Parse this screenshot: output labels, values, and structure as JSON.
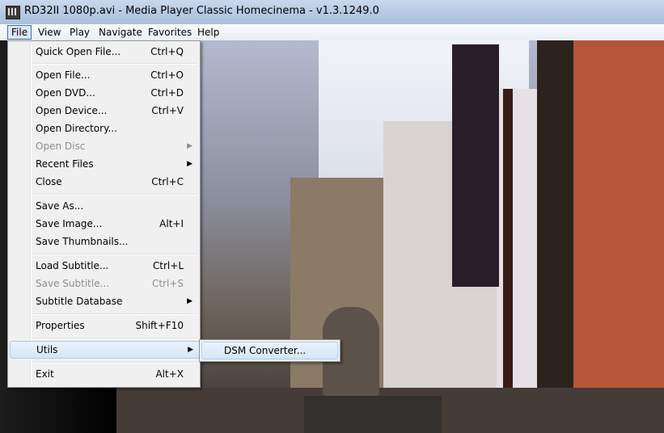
{
  "window": {
    "title": "RD32II 1080p.avi - Media Player Classic Homecinema - v1.3.1249.0",
    "icon": "film-icon"
  },
  "menubar": [
    "File",
    "View",
    "Play",
    "Navigate",
    "Favorites",
    "Help"
  ],
  "file_menu": {
    "items": [
      {
        "label": "Quick Open File...",
        "shortcut": "Ctrl+Q"
      },
      {
        "label": "Open File...",
        "shortcut": "Ctrl+O"
      },
      {
        "label": "Open DVD...",
        "shortcut": "Ctrl+D"
      },
      {
        "label": "Open Device...",
        "shortcut": "Ctrl+V"
      },
      {
        "label": "Open Directory...",
        "shortcut": ""
      },
      {
        "label": "Open Disc",
        "shortcut": ""
      },
      {
        "label": "Recent Files",
        "shortcut": ""
      },
      {
        "label": "Close",
        "shortcut": "Ctrl+C"
      },
      {
        "label": "Save As...",
        "shortcut": ""
      },
      {
        "label": "Save Image...",
        "shortcut": "Alt+I"
      },
      {
        "label": "Save Thumbnails...",
        "shortcut": ""
      },
      {
        "label": "Load Subtitle...",
        "shortcut": "Ctrl+L"
      },
      {
        "label": "Save Subtitle...",
        "shortcut": "Ctrl+S"
      },
      {
        "label": "Subtitle Database",
        "shortcut": ""
      },
      {
        "label": "Properties",
        "shortcut": "Shift+F10"
      },
      {
        "label": "Utils",
        "shortcut": ""
      },
      {
        "label": "Exit",
        "shortcut": "Alt+X"
      }
    ]
  },
  "utils_submenu": {
    "items": [
      "DSM Converter..."
    ]
  }
}
